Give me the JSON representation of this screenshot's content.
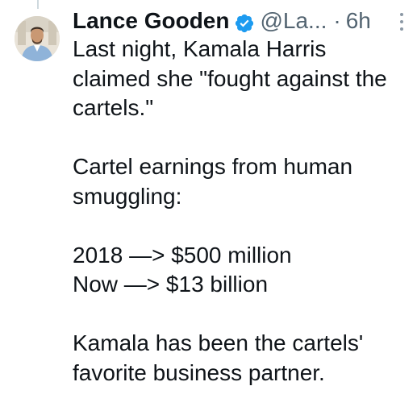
{
  "tweet": {
    "author_name": "Lance Gooden",
    "handle": "@La...",
    "separator": "·",
    "time": "6h",
    "verified_color": "#1d9bf0",
    "icons": {
      "verified": "verified-badge-icon",
      "more": "more-options-icon"
    },
    "paragraphs": [
      "Last night, Kamala Harris claimed she \"fought against the cartels.\"",
      "Cartel earnings from human smuggling:",
      "2018 —> $500 million",
      "Now —> $13 billion",
      "Kamala has been the cartels' favorite business partner."
    ]
  }
}
